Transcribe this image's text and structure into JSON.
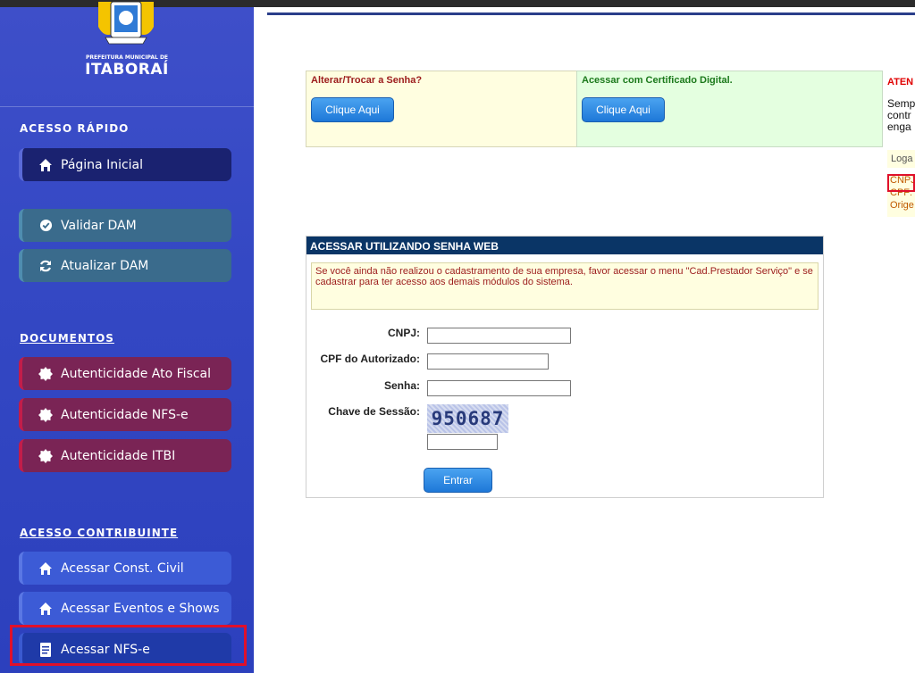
{
  "logo": {
    "small": "PREFEITURA MUNICIPAL DE",
    "big": "ITABORAÍ"
  },
  "sidebar": {
    "sections": [
      {
        "title": "ACESSO RÁPIDO"
      },
      {
        "title": "DOCUMENTOS"
      },
      {
        "title": "ACESSO CONTRIBUINTE"
      }
    ],
    "items": [
      {
        "label": "Página Inicial",
        "icon": "home-icon"
      },
      {
        "label": "Validar DAM",
        "icon": "check-circle-icon"
      },
      {
        "label": "Atualizar DAM",
        "icon": "refresh-icon"
      },
      {
        "label": "Autenticidade Ato Fiscal",
        "icon": "seal-icon"
      },
      {
        "label": "Autenticidade NFS-e",
        "icon": "seal-icon"
      },
      {
        "label": "Autenticidade ITBI",
        "icon": "seal-icon"
      },
      {
        "label": "Acessar Const. Civil",
        "icon": "home-icon"
      },
      {
        "label": "Acessar Eventos e Shows",
        "icon": "home-icon"
      },
      {
        "label": "Acessar NFS-e",
        "icon": "document-icon"
      }
    ]
  },
  "top_panels": {
    "password": {
      "label": "Alterar/Trocar a Senha?",
      "button": "Clique Aqui"
    },
    "certificate": {
      "label": "Acessar com Certificado Digital.",
      "button": "Clique Aqui"
    }
  },
  "notice": {
    "title": "ATEN",
    "lines": [
      "Semp",
      "contr",
      "enga"
    ],
    "logged": "Loga",
    "logged_lines": [
      "CNPJ",
      "CPF:",
      "Orige"
    ]
  },
  "login": {
    "title": "ACESSAR UTILIZANDO SENHA WEB",
    "info": "Se você ainda não realizou o cadastramento de sua empresa, favor acessar o menu \"Cad.Prestador Serviço\" e se cadastrar para ter acesso aos demais módulos do sistema.",
    "fields": {
      "cnpj": "CNPJ:",
      "cpf": "CPF do Autorizado:",
      "senha": "Senha:",
      "chave": "Chave de Sessão:"
    },
    "captcha": "950687",
    "submit": "Entrar"
  },
  "colors": {
    "sidebar": "#3448c4",
    "header_bar": "#0a3566",
    "highlight": "#e0102a"
  }
}
